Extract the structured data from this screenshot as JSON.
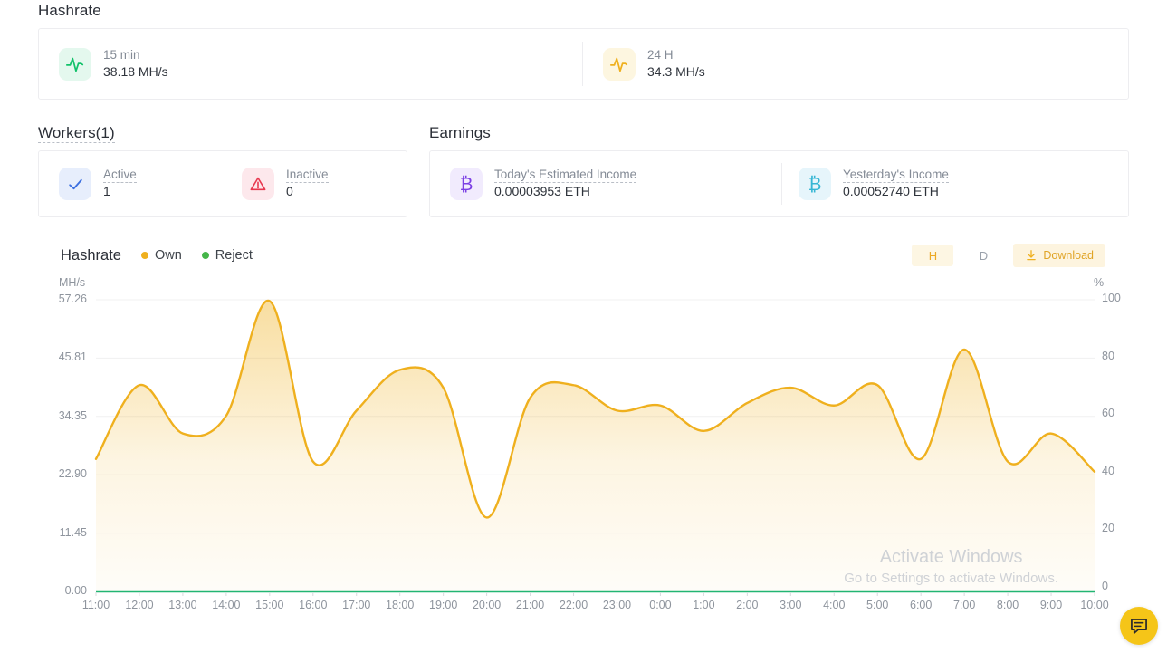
{
  "hashrate_section": {
    "title": "Hashrate",
    "stats": [
      {
        "label": "15 min",
        "value": "38.18 MH/s",
        "icon": "pulse-icon",
        "color": "#12c26a",
        "tile": "#e4f8ee"
      },
      {
        "label": "24 H",
        "value": "34.3 MH/s",
        "icon": "pulse-icon",
        "color": "#efb01e",
        "tile": "#fdf6e0"
      }
    ]
  },
  "workers_section": {
    "title": "Workers(1)",
    "stats": [
      {
        "label": "Active",
        "value": "1",
        "icon": "check-icon",
        "color": "#3b6fe0",
        "tile": "#e7eefc"
      },
      {
        "label": "Inactive",
        "value": "0",
        "icon": "warning-triangle-icon",
        "color": "#e8384f",
        "tile": "#fde8ec"
      }
    ]
  },
  "earnings_section": {
    "title": "Earnings",
    "stats": [
      {
        "label": "Today's Estimated Income",
        "value": "0.00003953 ETH",
        "icon": "bitcoin-icon",
        "color": "#7b3fe4",
        "tile": "#f1ebfd"
      },
      {
        "label": "Yesterday's Income",
        "value": "0.00052740 ETH",
        "icon": "bitcoin-icon",
        "color": "#35b6d4",
        "tile": "#e6f5fb"
      }
    ]
  },
  "chart_header": {
    "title": "Hashrate",
    "legend": [
      {
        "label": "Own",
        "color": "#efb01e"
      },
      {
        "label": "Reject",
        "color": "#45b649"
      }
    ],
    "range_toggles": [
      {
        "label": "H",
        "active": true
      },
      {
        "label": "D",
        "active": false
      }
    ],
    "download_label": "Download",
    "download_icon": "download-icon"
  },
  "chart_data": {
    "type": "area",
    "title": "Hashrate",
    "xlabel": "",
    "ylabel": "MH/s",
    "y2label": "%",
    "ylim": [
      0.0,
      57.26
    ],
    "y2lim": [
      0,
      100
    ],
    "grid": true,
    "legend_position": "top-left",
    "yticks": [
      "0.00",
      "11.45",
      "22.90",
      "34.35",
      "45.81",
      "57.26"
    ],
    "y2ticks": [
      "0",
      "20",
      "40",
      "60",
      "80",
      "100"
    ],
    "categories": [
      "11:00",
      "12:00",
      "13:00",
      "14:00",
      "15:00",
      "16:00",
      "17:00",
      "18:00",
      "19:00",
      "20:00",
      "21:00",
      "22:00",
      "23:00",
      "0:00",
      "1:00",
      "2:00",
      "3:00",
      "4:00",
      "5:00",
      "6:00",
      "7:00",
      "8:00",
      "9:00",
      "10:00"
    ],
    "series": [
      {
        "name": "Own",
        "color": "#efb01e",
        "unit": "MH/s",
        "values": [
          26.0,
          40.5,
          31.0,
          34.5,
          57.0,
          25.5,
          35.5,
          43.5,
          40.0,
          14.5,
          38.0,
          40.5,
          35.5,
          36.5,
          31.5,
          37.0,
          40.0,
          36.5,
          40.5,
          26.0,
          47.5,
          25.5,
          31.0,
          23.5
        ]
      },
      {
        "name": "Reject",
        "color": "#22b573",
        "unit": "%",
        "values": [
          0,
          0,
          0,
          0,
          0,
          0,
          0,
          0,
          0,
          0,
          0,
          0,
          0,
          0,
          0,
          0,
          0,
          0,
          0,
          0,
          0,
          0,
          0,
          0
        ]
      }
    ]
  },
  "watermark": {
    "title": "Activate Windows",
    "subtitle": "Go to Settings to activate Windows."
  },
  "chat": {
    "icon": "chat-bubble-icon"
  }
}
